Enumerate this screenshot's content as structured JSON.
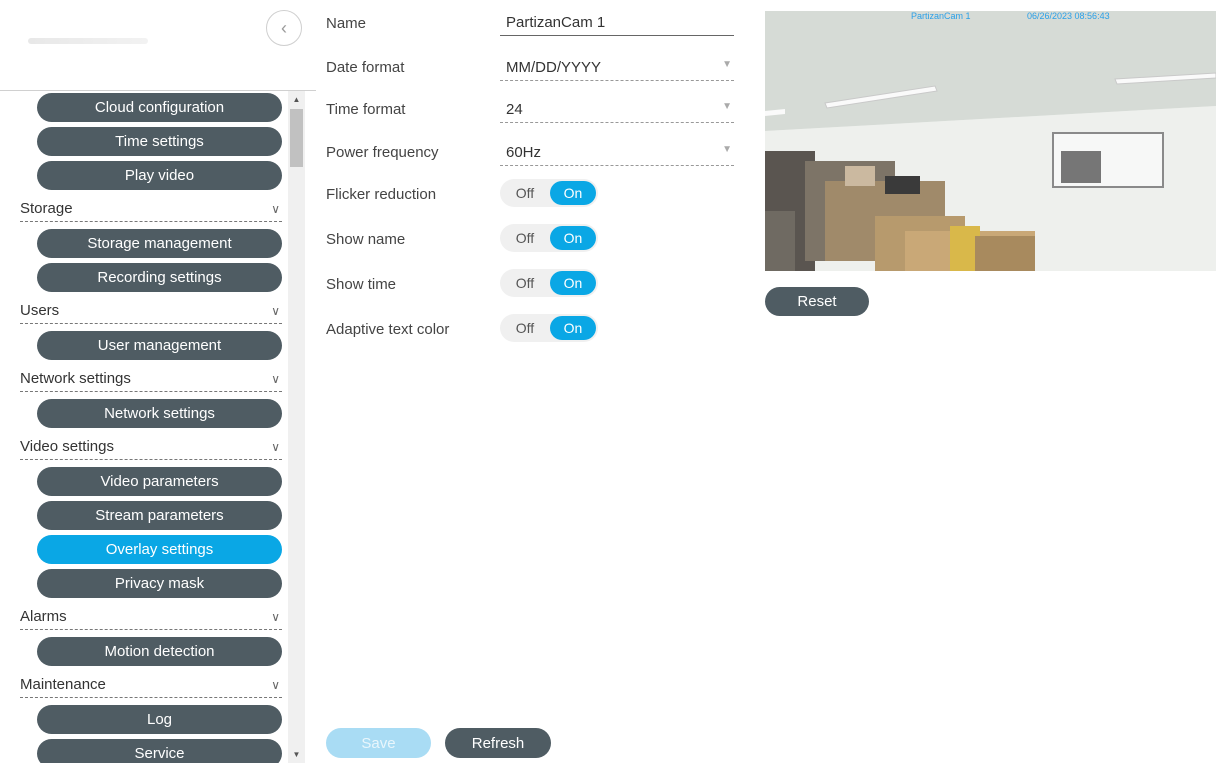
{
  "sidebar": {
    "collapse_icon": "chevron-left-icon",
    "items": [
      {
        "type": "button",
        "label": "Cloud configuration"
      },
      {
        "type": "button",
        "label": "Time settings"
      },
      {
        "type": "button",
        "label": "Play video"
      },
      {
        "type": "section",
        "label": "Storage"
      },
      {
        "type": "button",
        "label": "Storage management"
      },
      {
        "type": "button",
        "label": "Recording settings"
      },
      {
        "type": "section",
        "label": "Users"
      },
      {
        "type": "button",
        "label": "User management"
      },
      {
        "type": "section",
        "label": "Network settings"
      },
      {
        "type": "button",
        "label": "Network settings"
      },
      {
        "type": "section",
        "label": "Video settings"
      },
      {
        "type": "button",
        "label": "Video parameters"
      },
      {
        "type": "button",
        "label": "Stream parameters"
      },
      {
        "type": "button",
        "label": "Overlay settings",
        "active": true
      },
      {
        "type": "button",
        "label": "Privacy mask"
      },
      {
        "type": "section",
        "label": "Alarms"
      },
      {
        "type": "button",
        "label": "Motion detection"
      },
      {
        "type": "section",
        "label": "Maintenance"
      },
      {
        "type": "button",
        "label": "Log"
      },
      {
        "type": "button",
        "label": "Service"
      }
    ]
  },
  "form": {
    "name_label": "Name",
    "name_value": "PartizanCam 1",
    "date_format_label": "Date format",
    "date_format_value": "MM/DD/YYYY",
    "time_format_label": "Time format",
    "time_format_value": "24",
    "power_frequency_label": "Power frequency",
    "power_frequency_value": "60Hz",
    "toggles": [
      {
        "label": "Flicker reduction",
        "off": "Off",
        "on": "On",
        "state": "on"
      },
      {
        "label": "Show name",
        "off": "Off",
        "on": "On",
        "state": "on"
      },
      {
        "label": "Show time",
        "off": "Off",
        "on": "On",
        "state": "on"
      },
      {
        "label": "Adaptive text color",
        "off": "Off",
        "on": "On",
        "state": "on"
      }
    ]
  },
  "preview": {
    "osd_name": "PartizanCam 1",
    "osd_time": "06/26/2023 08:56:43",
    "reset_label": "Reset"
  },
  "actions": {
    "save_label": "Save",
    "refresh_label": "Refresh"
  },
  "colors": {
    "accent": "#0aa7e5",
    "button_dark": "#4f5c63",
    "save_disabled": "#a9dcf4"
  }
}
